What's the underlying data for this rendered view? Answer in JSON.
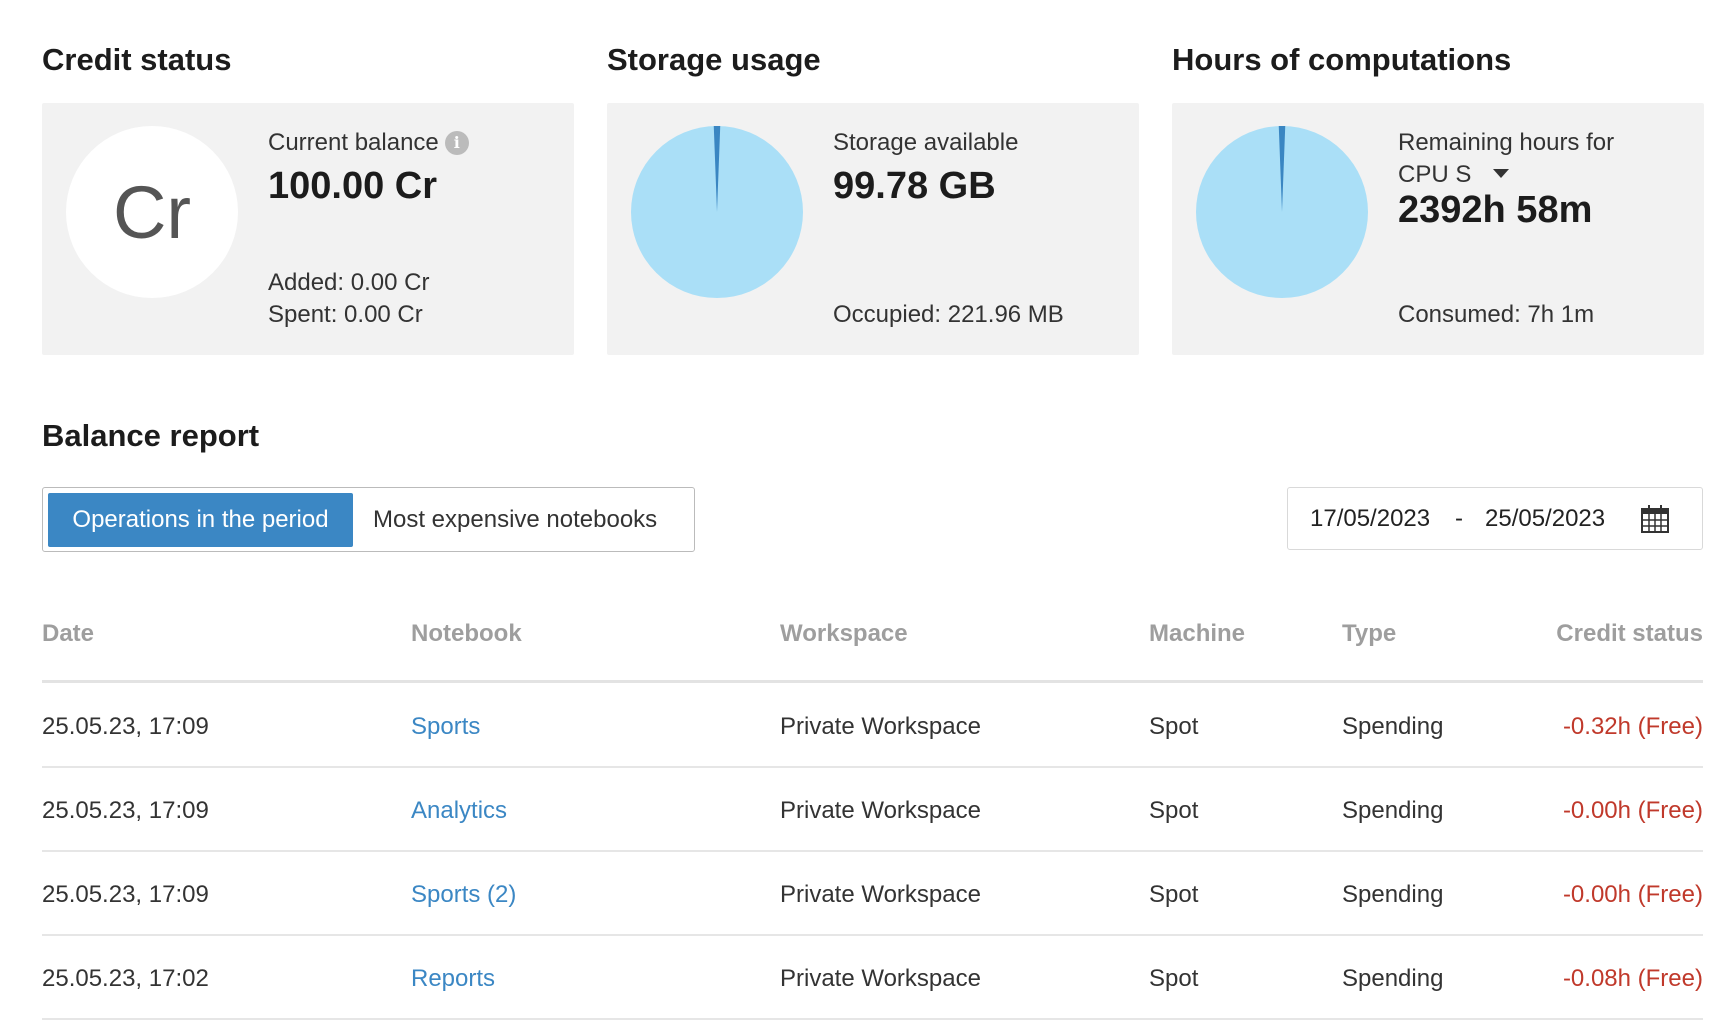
{
  "credit": {
    "title": "Credit status",
    "badge": "Cr",
    "balance_label": "Current balance",
    "balance_value": "100.00 Cr",
    "added": "Added: 0.00 Cr",
    "spent": "Spent: 0.00 Cr"
  },
  "storage": {
    "title": "Storage usage",
    "available_label": "Storage available",
    "available_value": "99.78 GB",
    "occupied": "Occupied: 221.96 MB",
    "used_fraction": 0.0022
  },
  "hours": {
    "title": "Hours of computations",
    "remaining_label": "Remaining hours for",
    "machine_selected": "CPU S",
    "remaining_value": "2392h 58m",
    "consumed": "Consumed: 7h 1m",
    "used_fraction": 0.0029
  },
  "colors": {
    "pie_free": "#aadff7",
    "pie_used": "#3a86c2",
    "accent": "#3b87c4",
    "negative": "#c0392b"
  },
  "report": {
    "title": "Balance report",
    "tabs": [
      {
        "label": "Operations in the period",
        "active": true
      },
      {
        "label": "Most expensive notebooks",
        "active": false
      }
    ],
    "date_from": "17/05/2023",
    "date_sep": "-",
    "date_to": "25/05/2023",
    "columns": [
      "Date",
      "Notebook",
      "Workspace",
      "Machine",
      "Type",
      "Credit status"
    ],
    "rows": [
      {
        "date": "25.05.23, 17:09",
        "notebook": "Sports",
        "workspace": "Private Workspace",
        "machine": "Spot",
        "type": "Spending",
        "credit": "-0.32h (Free)"
      },
      {
        "date": "25.05.23, 17:09",
        "notebook": "Analytics",
        "workspace": "Private Workspace",
        "machine": "Spot",
        "type": "Spending",
        "credit": "-0.00h (Free)"
      },
      {
        "date": "25.05.23, 17:09",
        "notebook": "Sports (2)",
        "workspace": "Private Workspace",
        "machine": "Spot",
        "type": "Spending",
        "credit": "-0.00h (Free)"
      },
      {
        "date": "25.05.23, 17:02",
        "notebook": "Reports",
        "workspace": "Private Workspace",
        "machine": "Spot",
        "type": "Spending",
        "credit": "-0.08h (Free)"
      }
    ]
  }
}
